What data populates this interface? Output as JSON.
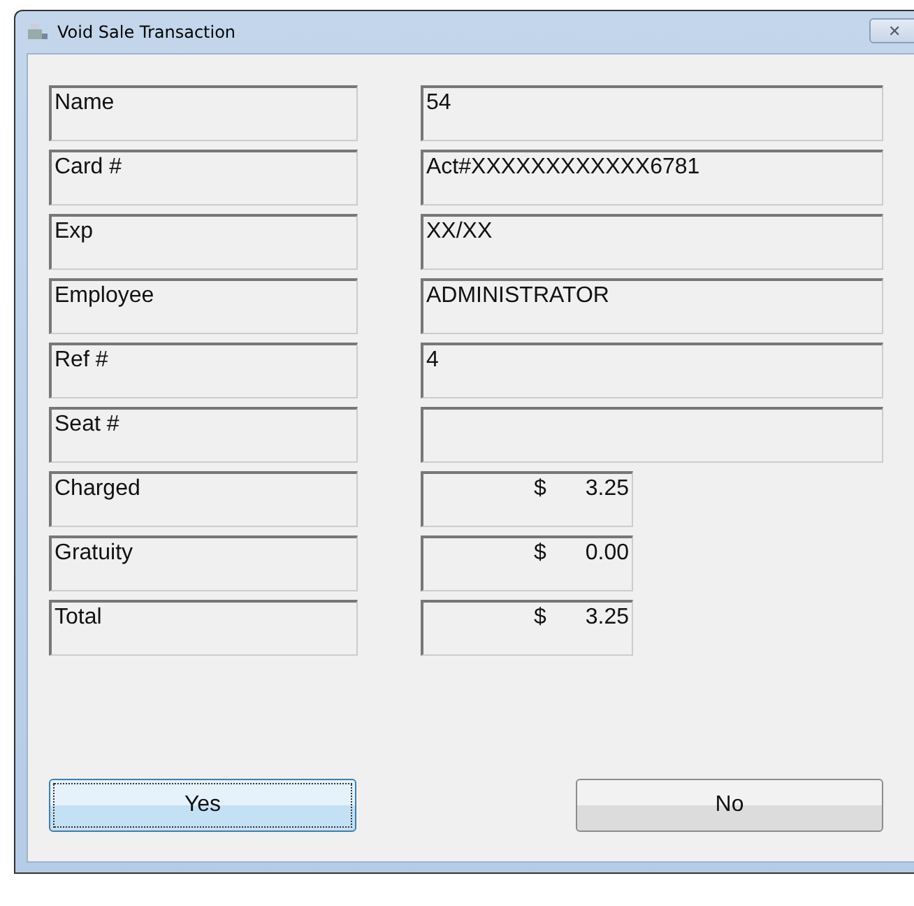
{
  "window": {
    "title": "Void Sale Transaction",
    "close": "✕"
  },
  "fields": [
    {
      "kind": "text",
      "label": "Name",
      "value": "54"
    },
    {
      "kind": "text",
      "label": "Card #",
      "value": "Act#XXXXXXXXXXXX6781"
    },
    {
      "kind": "text",
      "label": "Exp",
      "value": "XX/XX"
    },
    {
      "kind": "text",
      "label": "Employee",
      "value": "ADMINISTRATOR"
    },
    {
      "kind": "text",
      "label": "Ref #",
      "value": "4"
    },
    {
      "kind": "text",
      "label": "Seat #"
    },
    {
      "kind": "amount",
      "label": "Charged",
      "currency": "$",
      "value": "3.25"
    },
    {
      "kind": "amount",
      "label": "Gratuity",
      "currency": "$",
      "value": "0.00"
    },
    {
      "kind": "amount",
      "label": "Total",
      "currency": "$",
      "value": "3.25"
    }
  ],
  "buttons": [
    {
      "label": "Yes",
      "focused": true
    },
    {
      "label": "No",
      "focused": false
    }
  ]
}
